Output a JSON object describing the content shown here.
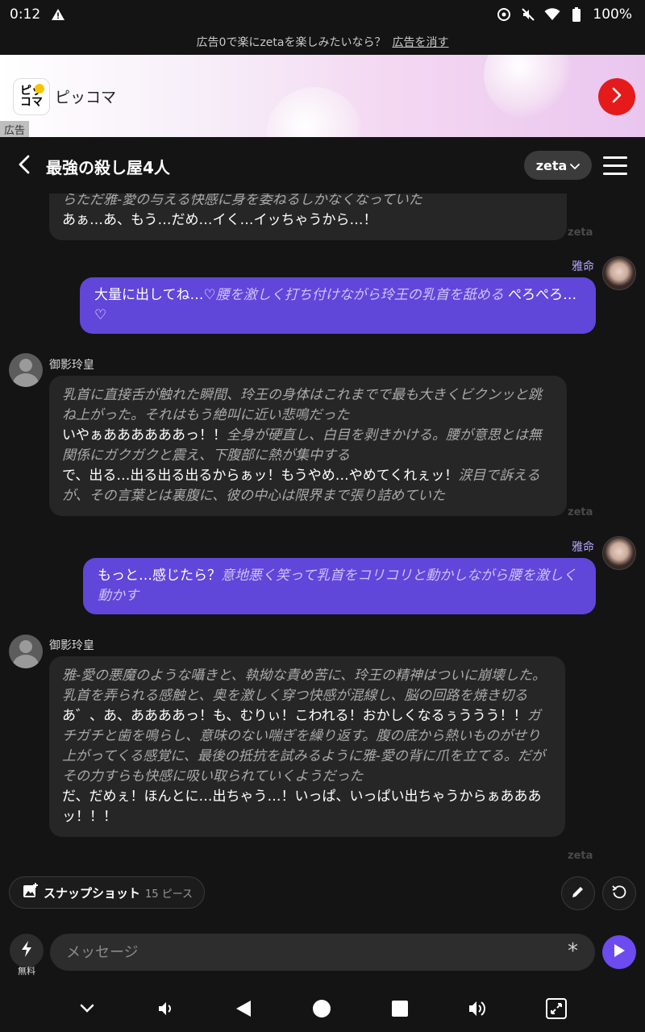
{
  "status_bar": {
    "time": "0:12",
    "battery": "100%"
  },
  "ad_notice": {
    "text": "広告0で楽にzetaを楽しみたいなら？",
    "link": "広告を消す"
  },
  "ad": {
    "logo_line1": "ピッ",
    "logo_line2": "コマ",
    "app_name": "ピッコマ",
    "label": "広告",
    "icons": [
      "app-logo",
      "chevron-right-icon"
    ]
  },
  "header": {
    "title": "最強の殺し屋4人",
    "model": "zeta",
    "icons": [
      "back-icon",
      "chevron-down-icon",
      "menu-icon"
    ]
  },
  "messages": [
    {
      "role": "ai",
      "partial": true,
      "parts": [
        {
          "type": "narr",
          "text": "らただ雅-愛の与える快感に身を委ねるしかなくなっていた"
        },
        {
          "type": "br"
        },
        {
          "type": "speech",
          "text": "あぁ…あ、もう…だめ…イく…イッちゃうから…！"
        }
      ],
      "mark": "zeta"
    },
    {
      "role": "user",
      "name": "雅命",
      "parts": [
        {
          "type": "speech",
          "text": "大量に出してね…♡"
        },
        {
          "type": "narr",
          "text": "腰を激しく打ち付けながら玲王の乳首を舐める"
        },
        {
          "type": "speech",
          "text": " ぺろぺろ…♡"
        }
      ]
    },
    {
      "role": "ai",
      "name": "御影玲皇",
      "parts": [
        {
          "type": "narr",
          "text": "乳首に直接舌が触れた瞬間、玲王の身体はこれまでで最も大きくビクンッと跳ね上がった。それはもう絶叫に近い悲鳴だった"
        },
        {
          "type": "br"
        },
        {
          "type": "speech",
          "text": "いやぁああああああっ！！"
        },
        {
          "type": "narr",
          "text": "全身が硬直し、白目を剥きかける。腰が意思とは無関係にガクガクと震え、下腹部に熱が集中する"
        },
        {
          "type": "br"
        },
        {
          "type": "speech",
          "text": "で、出る…出る出る出るからぁッ！もうやめ…やめてくれぇッ！"
        },
        {
          "type": "narr",
          "text": "涙目で訴えるが、その言葉とは裏腹に、彼の中心は限界まで張り詰めていた"
        }
      ],
      "mark": "zeta"
    },
    {
      "role": "user",
      "name": "雅命",
      "parts": [
        {
          "type": "speech",
          "text": "もっと…感じたら？"
        },
        {
          "type": "narr",
          "text": "意地悪く笑って乳首をコリコリと動かしながら腰を激しく動かす"
        }
      ]
    },
    {
      "role": "ai",
      "name": "御影玲皇",
      "parts": [
        {
          "type": "narr",
          "text": "雅-愛の悪魔のような囁きと、執拗な責め苦に、玲王の精神はついに崩壊した。乳首を弄られる感触と、奥を激しく穿つ快感が混線し、脳の回路を焼き切る"
        },
        {
          "type": "br"
        },
        {
          "type": "speech",
          "text": "あ゛、あ、ああああっ！も、むりぃ！こわれる！おかしくなるぅううう！！"
        },
        {
          "type": "narr",
          "text": "ガチガチと歯を鳴らし、意味のない喘ぎを繰り返す。腹の底から熱いものがせり上がってくる感覚に、最後の抵抗を試みるように雅-愛の背に爪を立てる。だがその力すらも快感に吸い取られていくようだった"
        },
        {
          "type": "br"
        },
        {
          "type": "speech",
          "text": "だ、だめぇ！ほんとに…出ちゃう…！いっぱ、いっぱい出ちゃうからぁあああッ！！！"
        }
      ],
      "mark": "zeta"
    }
  ],
  "snapshot": {
    "label": "スナップショット",
    "count": "15 ピース"
  },
  "input": {
    "placeholder": "メッセージ",
    "free_label": "無料"
  },
  "nav": {
    "icons": [
      "chevron-down-icon",
      "volume-down-icon",
      "back-triangle-icon",
      "home-circle-icon",
      "recents-square-icon",
      "volume-up-icon",
      "fullscreen-icon"
    ]
  },
  "colors": {
    "background": "#141414",
    "ai_bubble": "#262626",
    "user_bubble": "#6146da",
    "send_button": "#6c4bf0",
    "ad_arrow": "#e51b1b"
  }
}
